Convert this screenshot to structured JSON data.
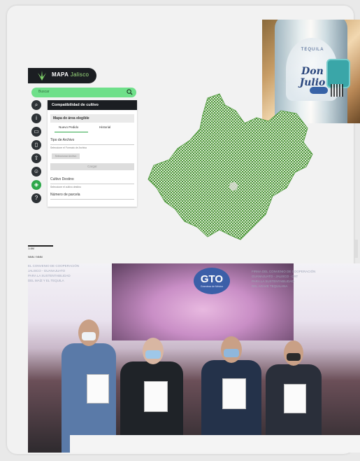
{
  "tequila_photo": {
    "brand": "Don Julio",
    "brand_small": "TEQUILA",
    "colors": {
      "glass": "#e9f3f7",
      "label_text": "#1f3e7a",
      "seal": "#3aa6a8"
    }
  },
  "map_app": {
    "title_main": "MAPA",
    "title_sub": "Jalisco",
    "search_placeholder": "Buscar",
    "panel_title": "Compatibilidad de cultivo",
    "section_header": "Mapa de área elegible",
    "tabs": [
      "Nuevo Pedido",
      "Historial"
    ],
    "file_type_label": "Tipo de Archivo",
    "file_type_hint": "Seleccione el Formato de Archivo",
    "select_file_button": "Seleccionar Archivo",
    "load_button": "Cargar",
    "crop_label": "Cultivo Destino",
    "crop_hint": "Seleccione el cultivo destino",
    "parcel_label": "Número de parcela",
    "toolbar_icons": [
      "search-icon",
      "info-icon",
      "image-icon",
      "document-icon",
      "upload-icon",
      "face-icon",
      "layers-icon",
      "help-icon"
    ],
    "colors": {
      "accent": "#2ea84a",
      "search_bg": "#6fe08a",
      "dark": "#1b1e22"
    }
  },
  "map": {
    "scale_text": "1:4M",
    "coords_text": "NNN / NNN",
    "fill_color": "#4f9a3a"
  },
  "event_photo": {
    "logo_text": "GTO",
    "logo_sub": "Grandeza de México",
    "left_banner_lines": [
      "EL CONVENIO DE COOPERACIÓN",
      "JALISCO - GUANAJUATO",
      "PARA LA SUSTENTABILIDAD",
      "DEL MAÍZ Y EL TEQUILA"
    ],
    "right_banner_lines": [
      "FIRMA DEL CONVENIO DE COOPERACIÓN",
      "GUANAJUATO - JALISCO - CRT",
      "PARA LA SUSTENTABILIDAD",
      "DEL AGAVE TEQUILANA"
    ]
  }
}
